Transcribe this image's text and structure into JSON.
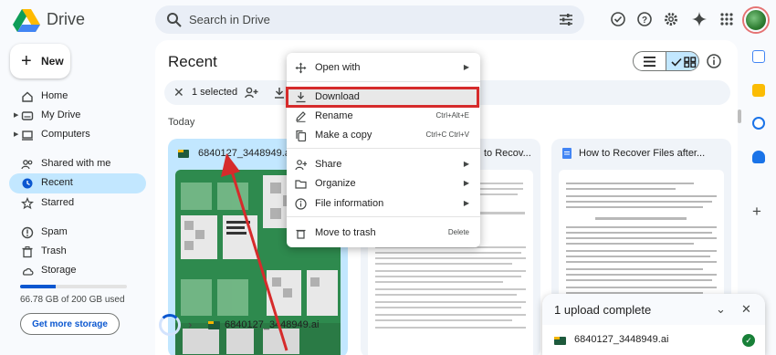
{
  "app": {
    "brand": "Drive"
  },
  "search": {
    "placeholder": "Search in Drive"
  },
  "sidebar": {
    "new_label": "New",
    "items": [
      {
        "label": "Home",
        "icon": "home-icon",
        "caret": false
      },
      {
        "label": "My Drive",
        "icon": "my-drive-icon",
        "caret": true
      },
      {
        "label": "Computers",
        "icon": "computers-icon",
        "caret": true
      },
      {
        "label": "Shared with me",
        "icon": "shared-icon",
        "caret": false
      },
      {
        "label": "Recent",
        "icon": "clock-icon",
        "caret": false,
        "active": true
      },
      {
        "label": "Starred",
        "icon": "star-icon",
        "caret": false
      },
      {
        "label": "Spam",
        "icon": "spam-icon",
        "caret": false
      },
      {
        "label": "Trash",
        "icon": "trash-icon",
        "caret": false
      },
      {
        "label": "Storage",
        "icon": "cloud-icon",
        "caret": false
      }
    ],
    "storage_text": "66.78 GB of 200 GB used",
    "storage_fraction": 0.334,
    "more_storage": "Get more storage"
  },
  "main": {
    "title": "Recent",
    "selection": "1 selected",
    "section": "Today",
    "cards": [
      {
        "name": "6840127_3448949.ai",
        "icon": "ai-file-icon"
      },
      {
        "name": "to Recov...",
        "icon": "doc-icon"
      },
      {
        "name": "How to Recover Files after...",
        "icon": "doc-icon"
      }
    ]
  },
  "menu": {
    "items": [
      {
        "label": "Open with",
        "shortcut": "",
        "arrow": true,
        "icon": "open-with-icon"
      },
      {
        "label": "Download",
        "shortcut": "",
        "arrow": false,
        "icon": "download-icon",
        "highlight": true
      },
      {
        "label": "Rename",
        "shortcut": "Ctrl+Alt+E",
        "arrow": false,
        "icon": "rename-icon"
      },
      {
        "label": "Make a copy",
        "shortcut": "Ctrl+C Ctrl+V",
        "arrow": false,
        "icon": "copy-icon"
      },
      {
        "label": "Share",
        "shortcut": "",
        "arrow": true,
        "icon": "share-icon"
      },
      {
        "label": "Organize",
        "shortcut": "",
        "arrow": true,
        "icon": "organize-icon"
      },
      {
        "label": "File information",
        "shortcut": "",
        "arrow": true,
        "icon": "info-icon"
      },
      {
        "label": "Move to trash",
        "shortcut": "Delete",
        "arrow": false,
        "icon": "trash-icon"
      }
    ]
  },
  "upload": {
    "strip_name": "6840127_3448949.ai",
    "panel_title": "1 upload complete",
    "file_name": "6840127_3448949.ai"
  },
  "colors": {
    "accent": "#0b57d0",
    "selection": "#c2e7ff",
    "highlight_border": "#d62b2b",
    "arrow": "#d62b2b"
  }
}
